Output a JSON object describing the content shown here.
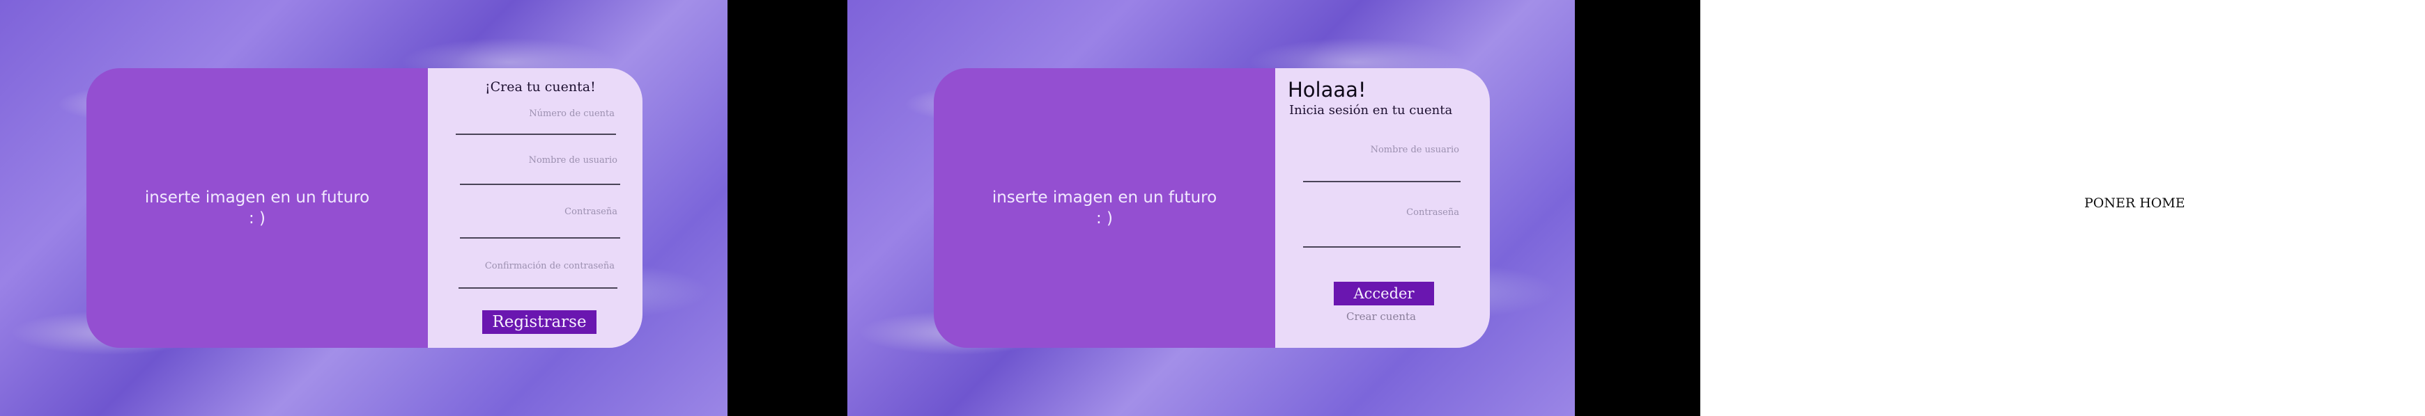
{
  "register_screen": {
    "image_placeholder": "inserte imagen en un futuro",
    "image_placeholder_face": ": )",
    "title": "¡Crea tu cuenta!",
    "fields": [
      {
        "label": "Número de cuenta",
        "value": ""
      },
      {
        "label": "Nombre de usuario",
        "value": ""
      },
      {
        "label": "Contraseña",
        "value": ""
      },
      {
        "label": "Confirmación de contraseña",
        "value": ""
      }
    ],
    "submit_label": "Registrarse"
  },
  "login_screen": {
    "image_placeholder": "inserte imagen en un futuro",
    "image_placeholder_face": ": )",
    "greeting": "Holaaa!",
    "subtitle": "Inicia sesión en tu cuenta",
    "fields": [
      {
        "label": "Nombre de usuario",
        "value": ""
      },
      {
        "label": "Contraseña",
        "value": ""
      }
    ],
    "submit_label": "Acceder",
    "create_account_link": "Crear cuenta"
  },
  "home_screen": {
    "placeholder_text": "PONER HOME"
  },
  "colors": {
    "card_left": "#944fd1",
    "card_right": "#eadaf9",
    "button": "#6a16b0",
    "background_black": "#000000"
  }
}
